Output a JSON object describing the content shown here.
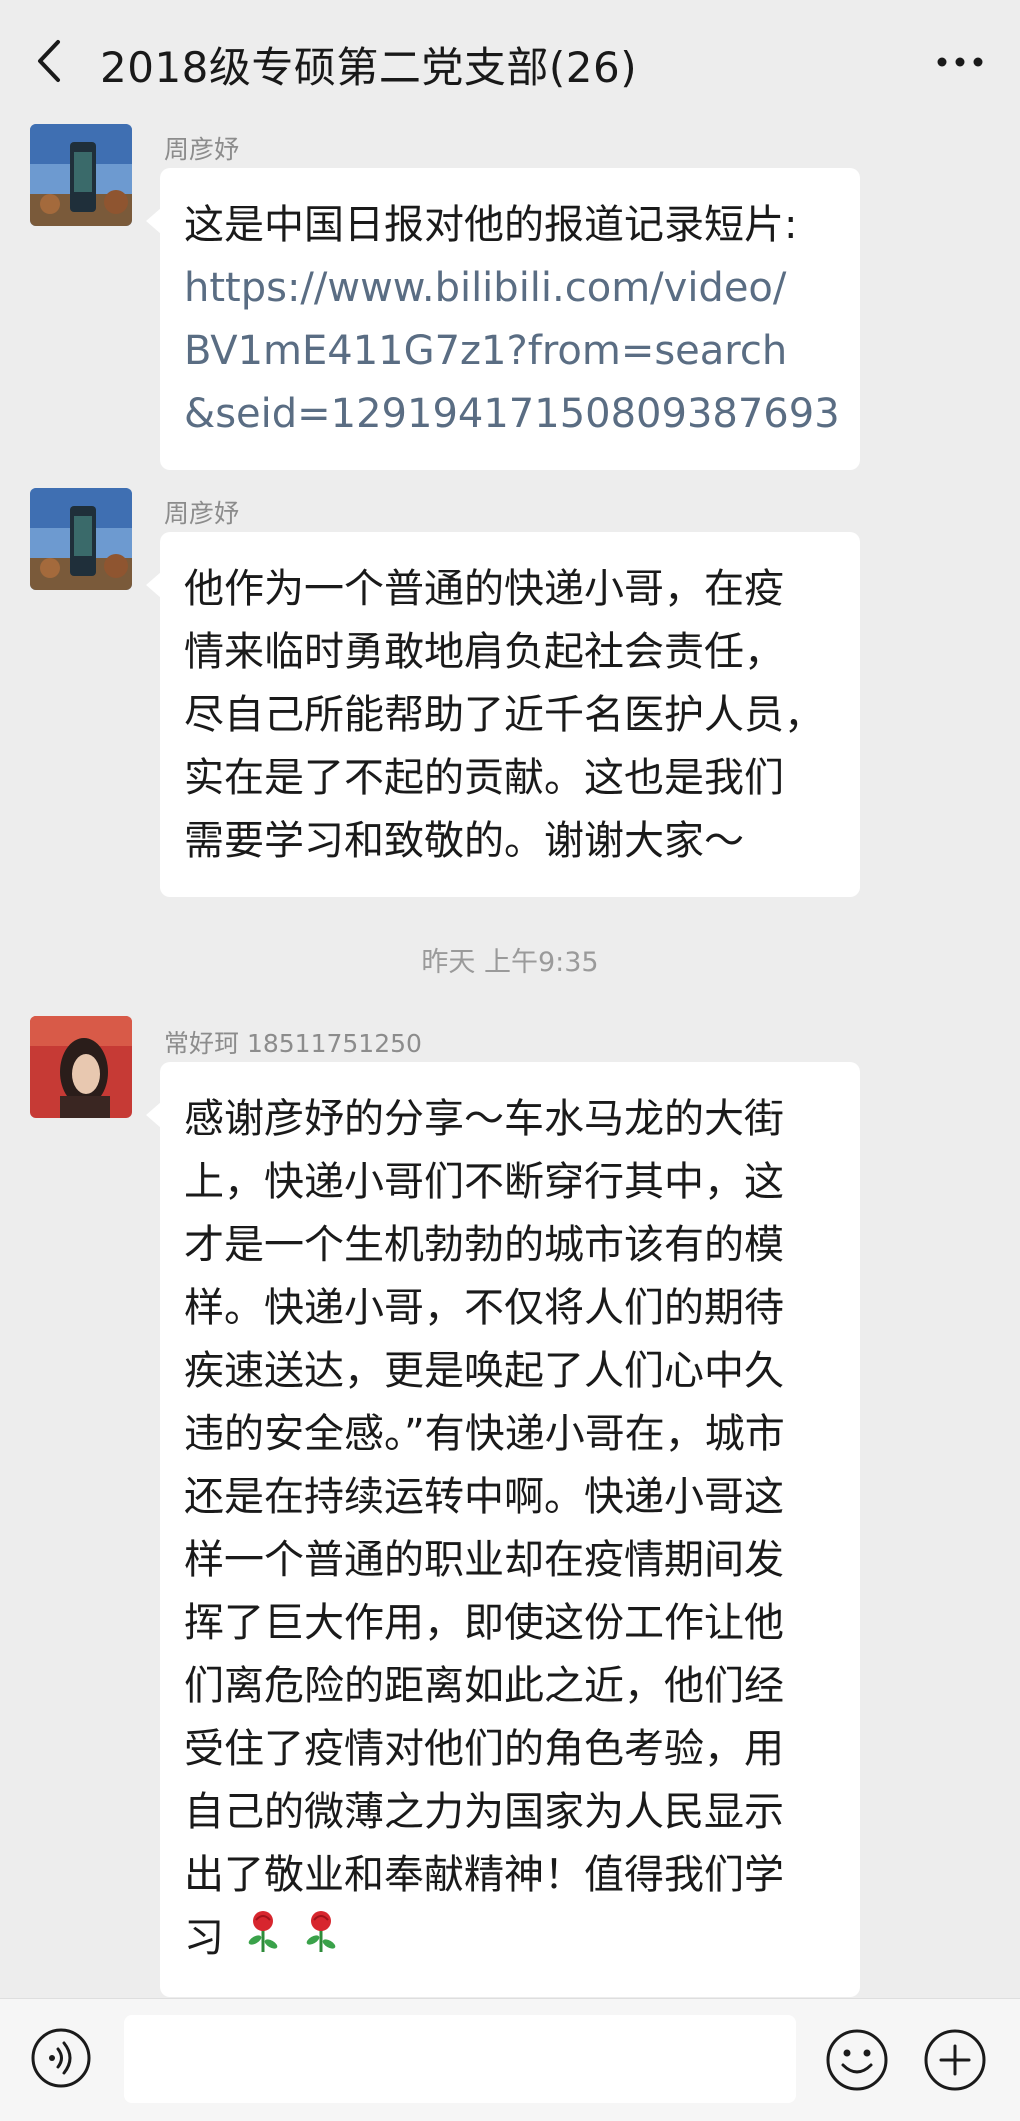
{
  "header": {
    "title": "2018级专硕第二党支部(26)"
  },
  "messages": [
    {
      "sender": "周彦妤",
      "lines": [
        "这是中国日报对他的报道记录短片:"
      ],
      "link_lines": [
        "https://www.bilibili.com/video/",
        "BV1mE411G7z1?from=search",
        "&seid=12919417150809387693"
      ]
    },
    {
      "sender": "周彦妤",
      "lines": [
        "他作为一个普通的快递小哥，在疫",
        "情来临时勇敢地肩负起社会责任，",
        "尽自己所能帮助了近千名医护人员，",
        "实在是了不起的贡献。这也是我们",
        "需要学习和致敬的。谢谢大家～"
      ]
    },
    {
      "sender": "常好珂 18511751250",
      "lines": [
        "感谢彦妤的分享～车水马龙的大街",
        "上，快递小哥们不断穿行其中，这",
        "才是一个生机勃勃的城市该有的模",
        "样。快递小哥，不仅将人们的期待",
        "疾速送达，更是唤起了人们心中久",
        "违的安全感。”有快递小哥在，城市",
        "还是在持续运转中啊。快递小哥这",
        "样一个普通的职业却在疫情期间发",
        "挥了巨大作用，即使这份工作让他",
        "们离危险的距离如此之近，他们经",
        "受住了疫情对他们的角色考验，用",
        "自己的微薄之力为国家为人民显示",
        "出了敬业和奉献精神！值得我们学",
        "习"
      ],
      "emoji": [
        "rose-icon",
        "rose-icon"
      ]
    }
  ],
  "timestamp": "昨天 上午9:35",
  "icons": {
    "back": "chevron-left-icon",
    "more": "more-dots-icon",
    "voice": "voice-icon",
    "emoji": "emoji-icon",
    "plus": "plus-icon"
  },
  "colors": {
    "background": "#ededed",
    "bubble": "#ffffff",
    "link": "#5a6d83"
  }
}
